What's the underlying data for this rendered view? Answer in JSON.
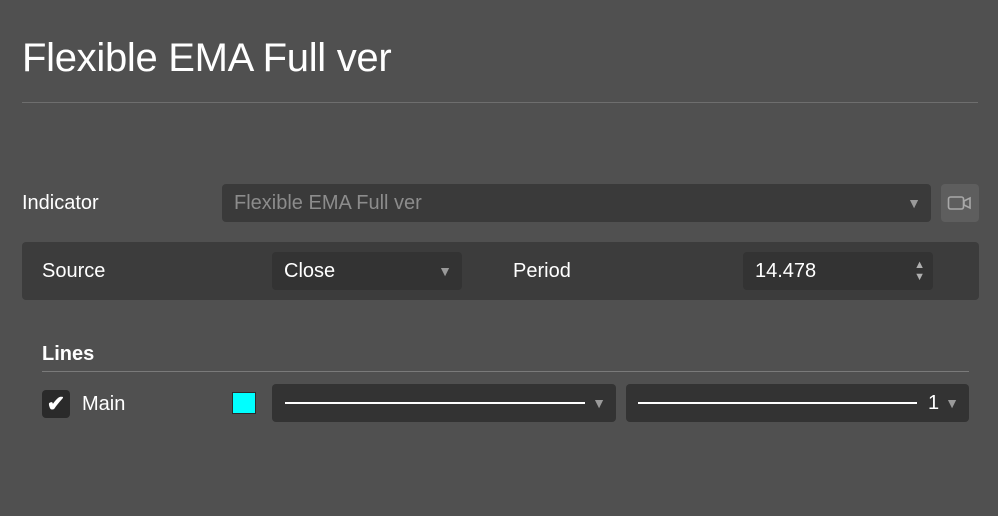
{
  "header": {
    "title": "Flexible EMA Full ver"
  },
  "indicator": {
    "label": "Indicator",
    "selected": "Flexible EMA Full ver",
    "icon": "camera-icon"
  },
  "params": {
    "source_label": "Source",
    "source_value": "Close",
    "period_label": "Period",
    "period_value": "14.478"
  },
  "lines": {
    "section_title": "Lines",
    "items": [
      {
        "label": "Main",
        "checked": true,
        "color": "#00ffff",
        "style": "solid",
        "width_value": "1"
      }
    ]
  },
  "colors": {
    "background": "#505050",
    "field": "#333333",
    "panel": "#3c3c3c"
  }
}
